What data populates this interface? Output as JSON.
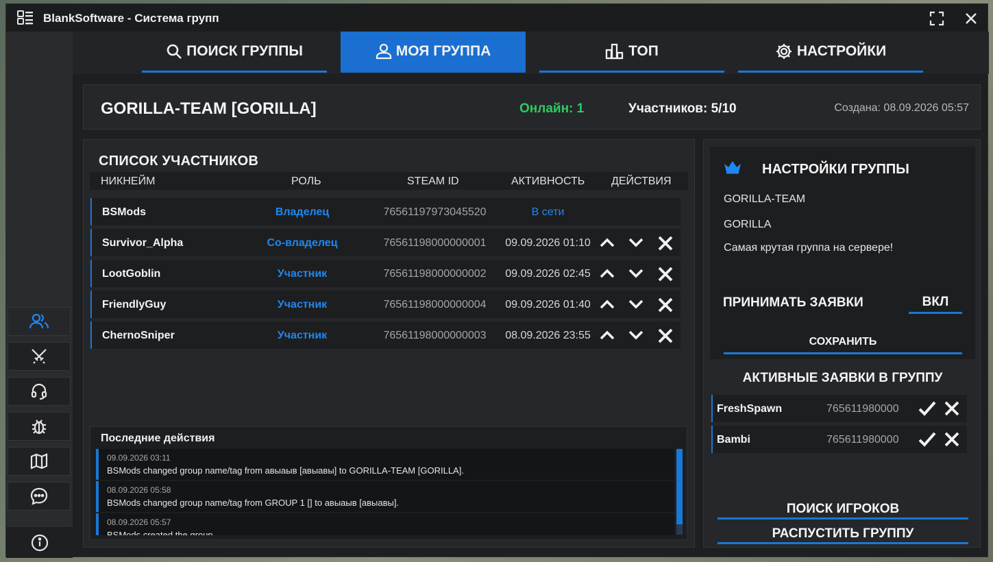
{
  "window": {
    "title": "BlankSoftware - Система групп",
    "icons": [
      "menu-list-icon",
      "fullscreen-icon",
      "close-icon"
    ]
  },
  "sidebar": {
    "items": [
      {
        "icon": "users-icon",
        "active": true
      },
      {
        "icon": "crossed-swords-icon",
        "active": false
      },
      {
        "icon": "headset-icon",
        "active": false
      },
      {
        "icon": "bug-icon",
        "active": false
      },
      {
        "icon": "map-icon",
        "active": false
      },
      {
        "icon": "chat-icon",
        "active": false
      }
    ],
    "info_icon": "info-icon"
  },
  "tabs": [
    {
      "label": "ПОИСК ГРУППЫ",
      "icon": "search-icon",
      "active": false
    },
    {
      "label": "МОЯ ГРУППА",
      "icon": "user-icon",
      "active": true
    },
    {
      "label": "ТОП",
      "icon": "bar-chart-icon",
      "active": false
    },
    {
      "label": "НАСТРОЙКИ",
      "icon": "gear-icon",
      "active": false
    }
  ],
  "group": {
    "name": "GORILLA-TEAM [GORILLA]",
    "online": "Онлайн: 1",
    "members": "Участников: 5/10",
    "created": "Создана: 08.09.2026 05:57"
  },
  "members_list": {
    "title": "СПИСОК УЧАСТНИКОВ",
    "columns": [
      "НИКНЕЙМ",
      "РОЛЬ",
      "STEAM ID",
      "АКТИВНОСТЬ",
      "ДЕЙСТВИЯ"
    ],
    "rows": [
      {
        "nick": "BSMods",
        "role": "Владелец",
        "steam_id": "76561197973045520",
        "activity": "В сети",
        "actions": false
      },
      {
        "nick": "Survivor_Alpha",
        "role": "Со-владелец",
        "steam_id": "76561198000000001",
        "activity": "09.09.2026 01:10",
        "actions": true
      },
      {
        "nick": "LootGoblin",
        "role": "Участник",
        "steam_id": "76561198000000002",
        "activity": "09.09.2026 02:45",
        "actions": true
      },
      {
        "nick": "FriendlyGuy",
        "role": "Участник",
        "steam_id": "76561198000000004",
        "activity": "09.09.2026 01:40",
        "actions": true
      },
      {
        "nick": "ChernoSniper",
        "role": "Участник",
        "steam_id": "76561198000000003",
        "activity": "08.09.2026 23:55",
        "actions": true
      }
    ]
  },
  "recent_actions": {
    "title": "Последние действия",
    "items": [
      {
        "time": "09.09.2026 03:11",
        "text": "BSMods changed group name/tag from авыаыв [авыавы] to GORILLA-TEAM [GORILLA]."
      },
      {
        "time": "08.09.2026 05:58",
        "text": "BSMods changed group name/tag from GROUP 1 [] to авыаыв [авыавы]."
      },
      {
        "time": "08.09.2026 05:57",
        "text": "BSMods created the group."
      }
    ]
  },
  "group_settings": {
    "title": "НАСТРОЙКИ ГРУППЫ",
    "name": "GORILLA-TEAM",
    "tag": "GORILLA",
    "description": "Самая крутая группа на сервере!",
    "accept_label": "ПРИНИМАТЬ ЗАЯВКИ",
    "accept_value": "ВКЛ",
    "save_label": "СОХРАНИТЬ"
  },
  "requests": {
    "title": "АКТИВНЫЕ ЗАЯВКИ В ГРУППУ",
    "items": [
      {
        "nick": "FreshSpawn",
        "steam_id": "765611980000"
      },
      {
        "nick": "Bambi",
        "steam_id": "765611980000"
      }
    ]
  },
  "buttons": {
    "find_players": "ПОИСК ИГРОКОВ",
    "disband": "РАСПУСТИТЬ ГРУППУ"
  },
  "colors": {
    "accent": "#1a78d6",
    "online": "#2ecc60",
    "role": "#1e88f0"
  }
}
